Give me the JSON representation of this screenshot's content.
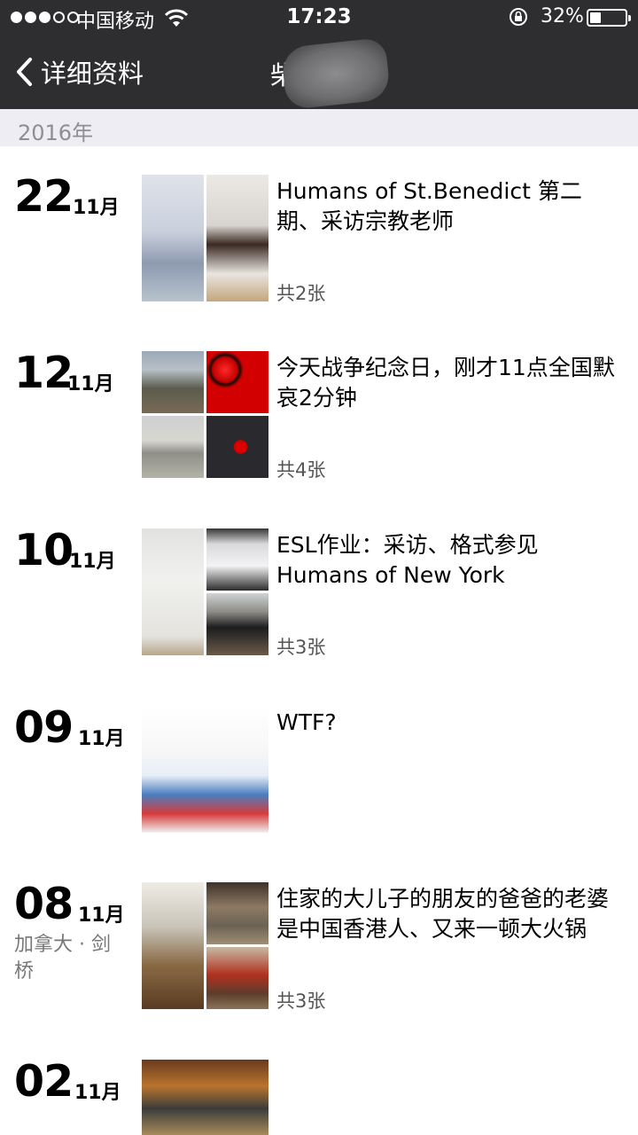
{
  "status_bar": {
    "carrier": "中国移动",
    "time": "17:23",
    "battery": "32%",
    "battery_level": 0.32,
    "signal_bars": 3,
    "signal_total": 5
  },
  "nav": {
    "back_label": "详细资料",
    "title": "柴"
  },
  "year_header": "2016年",
  "entries": [
    {
      "day": "22",
      "month": "11月",
      "caption": "Humans of St.Benedict 第二期、采访宗教老师",
      "count": "共2张"
    },
    {
      "day": "12",
      "month": "11月",
      "caption": "今天战争纪念日，刚才11点全国默哀2分钟",
      "count": "共4张"
    },
    {
      "day": "10",
      "month": "11月",
      "caption": "ESL作业：采访、格式参见 Humans of New York",
      "count": "共3张"
    },
    {
      "day": "09",
      "month": "11月",
      "caption": "WTF?",
      "count": ""
    },
    {
      "day": "08",
      "month": "11月",
      "location": "加拿大 · 剑桥",
      "caption": "住家的大儿子的朋友的爸爸的老婆是中国香港人、又来一顿大火锅",
      "count": "共3张"
    },
    {
      "day": "02",
      "month": "11月",
      "caption": "",
      "count": ""
    }
  ]
}
